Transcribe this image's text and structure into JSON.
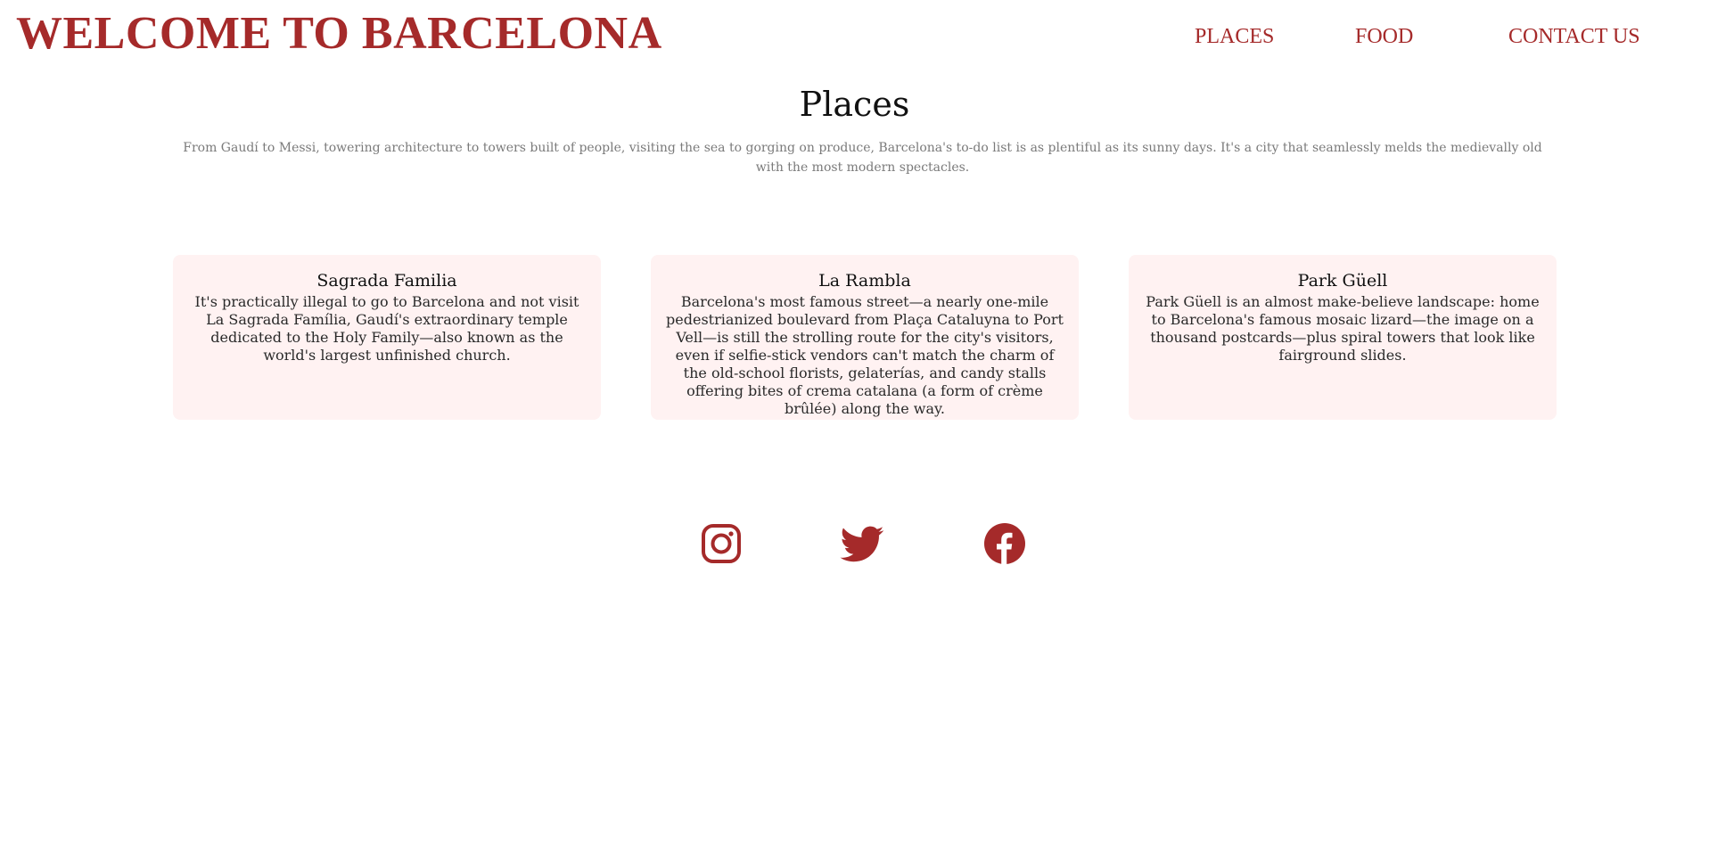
{
  "header": {
    "title": "WELCOME TO BARCELONA",
    "nav": [
      {
        "label": "PLACES"
      },
      {
        "label": "FOOD"
      },
      {
        "label": "CONTACT US"
      }
    ]
  },
  "places": {
    "title": "Places",
    "intro": "From Gaudí to Messi, towering architecture to towers built of people, visiting the sea to gorging on produce, Barcelona's to-do list is as plentiful as its sunny days. It's a city that seamlessly melds the medievally old with the most modern spectacles.",
    "cards": [
      {
        "title": "Sagrada Familia",
        "text": "It's practically illegal to go to Barcelona and not visit La Sagrada Família, Gaudí's extraordinary temple dedicated to the Holy Family—also known as the world's largest unfinished church."
      },
      {
        "title": "La Rambla",
        "text": "Barcelona's most famous street—a nearly one-mile pedestrianized boulevard from Plaça Cataluyna to Port Vell—is still the strolling route for the city's visitors, even if selfie-stick vendors can't match the charm of the old-school florists, gelaterías, and candy stalls offering bites of crema catalana (a form of crème brûlée) along the way."
      },
      {
        "title": "Park Güell",
        "text": "Park Güell is an almost make-believe landscape: home to Barcelona's famous mosaic lizard—the image on a thousand postcards—plus spiral towers that look like fairground slides."
      }
    ]
  },
  "social": {
    "icons": [
      "instagram-icon",
      "twitter-icon",
      "facebook-icon"
    ]
  },
  "colors": {
    "accent": "#a52a2a",
    "card_background": "#fff2f2",
    "muted_text": "#7a7a7a"
  }
}
